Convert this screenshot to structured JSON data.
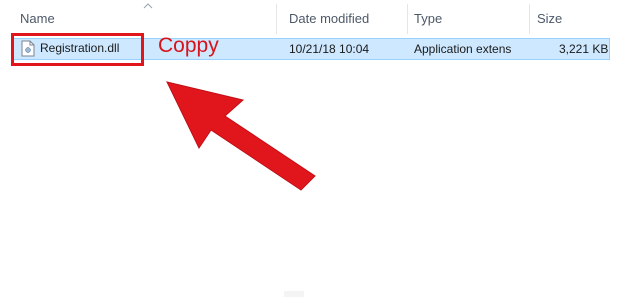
{
  "columns": {
    "name": "Name",
    "date_modified": "Date modified",
    "type": "Type",
    "size": "Size"
  },
  "file": {
    "name": "Registration.dll",
    "date_modified": "10/21/18 10:04",
    "type": "Application extens",
    "size": "3,221 KB",
    "icon": "dll-file-icon"
  },
  "annotation": {
    "text": "Coppy",
    "color": "#e0161c"
  },
  "colors": {
    "selection_bg": "#cde8ff",
    "selection_border": "#99d1ff",
    "highlight": "#e0161c"
  }
}
